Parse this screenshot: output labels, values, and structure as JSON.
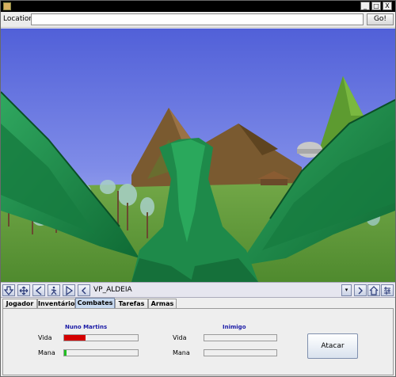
{
  "location": {
    "label": "Location:",
    "value": "",
    "go_label": "Go!"
  },
  "window_buttons": {
    "minimize": "_",
    "maximize": "□",
    "close": "X"
  },
  "nav": {
    "viewpoint": "VP_ALDEIA",
    "dropdown_glyph": "▾"
  },
  "tabs": [
    {
      "label": "Jogador"
    },
    {
      "label": "Inventário"
    },
    {
      "label": "Combates",
      "active": true
    },
    {
      "label": "Tarefas"
    },
    {
      "label": "Armas"
    }
  ],
  "combat": {
    "player": {
      "name": "Nuno Martins",
      "vida_label": "Vida",
      "mana_label": "Mana",
      "vida_level": 0.29,
      "mana_level": 0.03,
      "vida_color": "#d40000",
      "mana_color": "#22c022"
    },
    "enemy": {
      "name": "Inimigo",
      "vida_label": "Vida",
      "mana_label": "Mana",
      "vida_level": 0,
      "mana_level": 0
    },
    "attack_label": "Atacar"
  },
  "colors": {
    "sky": "#5a6ad8",
    "grass": "#5d9a3a",
    "dragon": "#1d8a4a"
  },
  "icons": [
    "down-arrow-icon",
    "pan-icon",
    "back-icon",
    "walk-icon",
    "forward-icon",
    "prev-viewpoint-icon",
    "next-viewpoint-icon",
    "home-icon",
    "settings-icon"
  ]
}
